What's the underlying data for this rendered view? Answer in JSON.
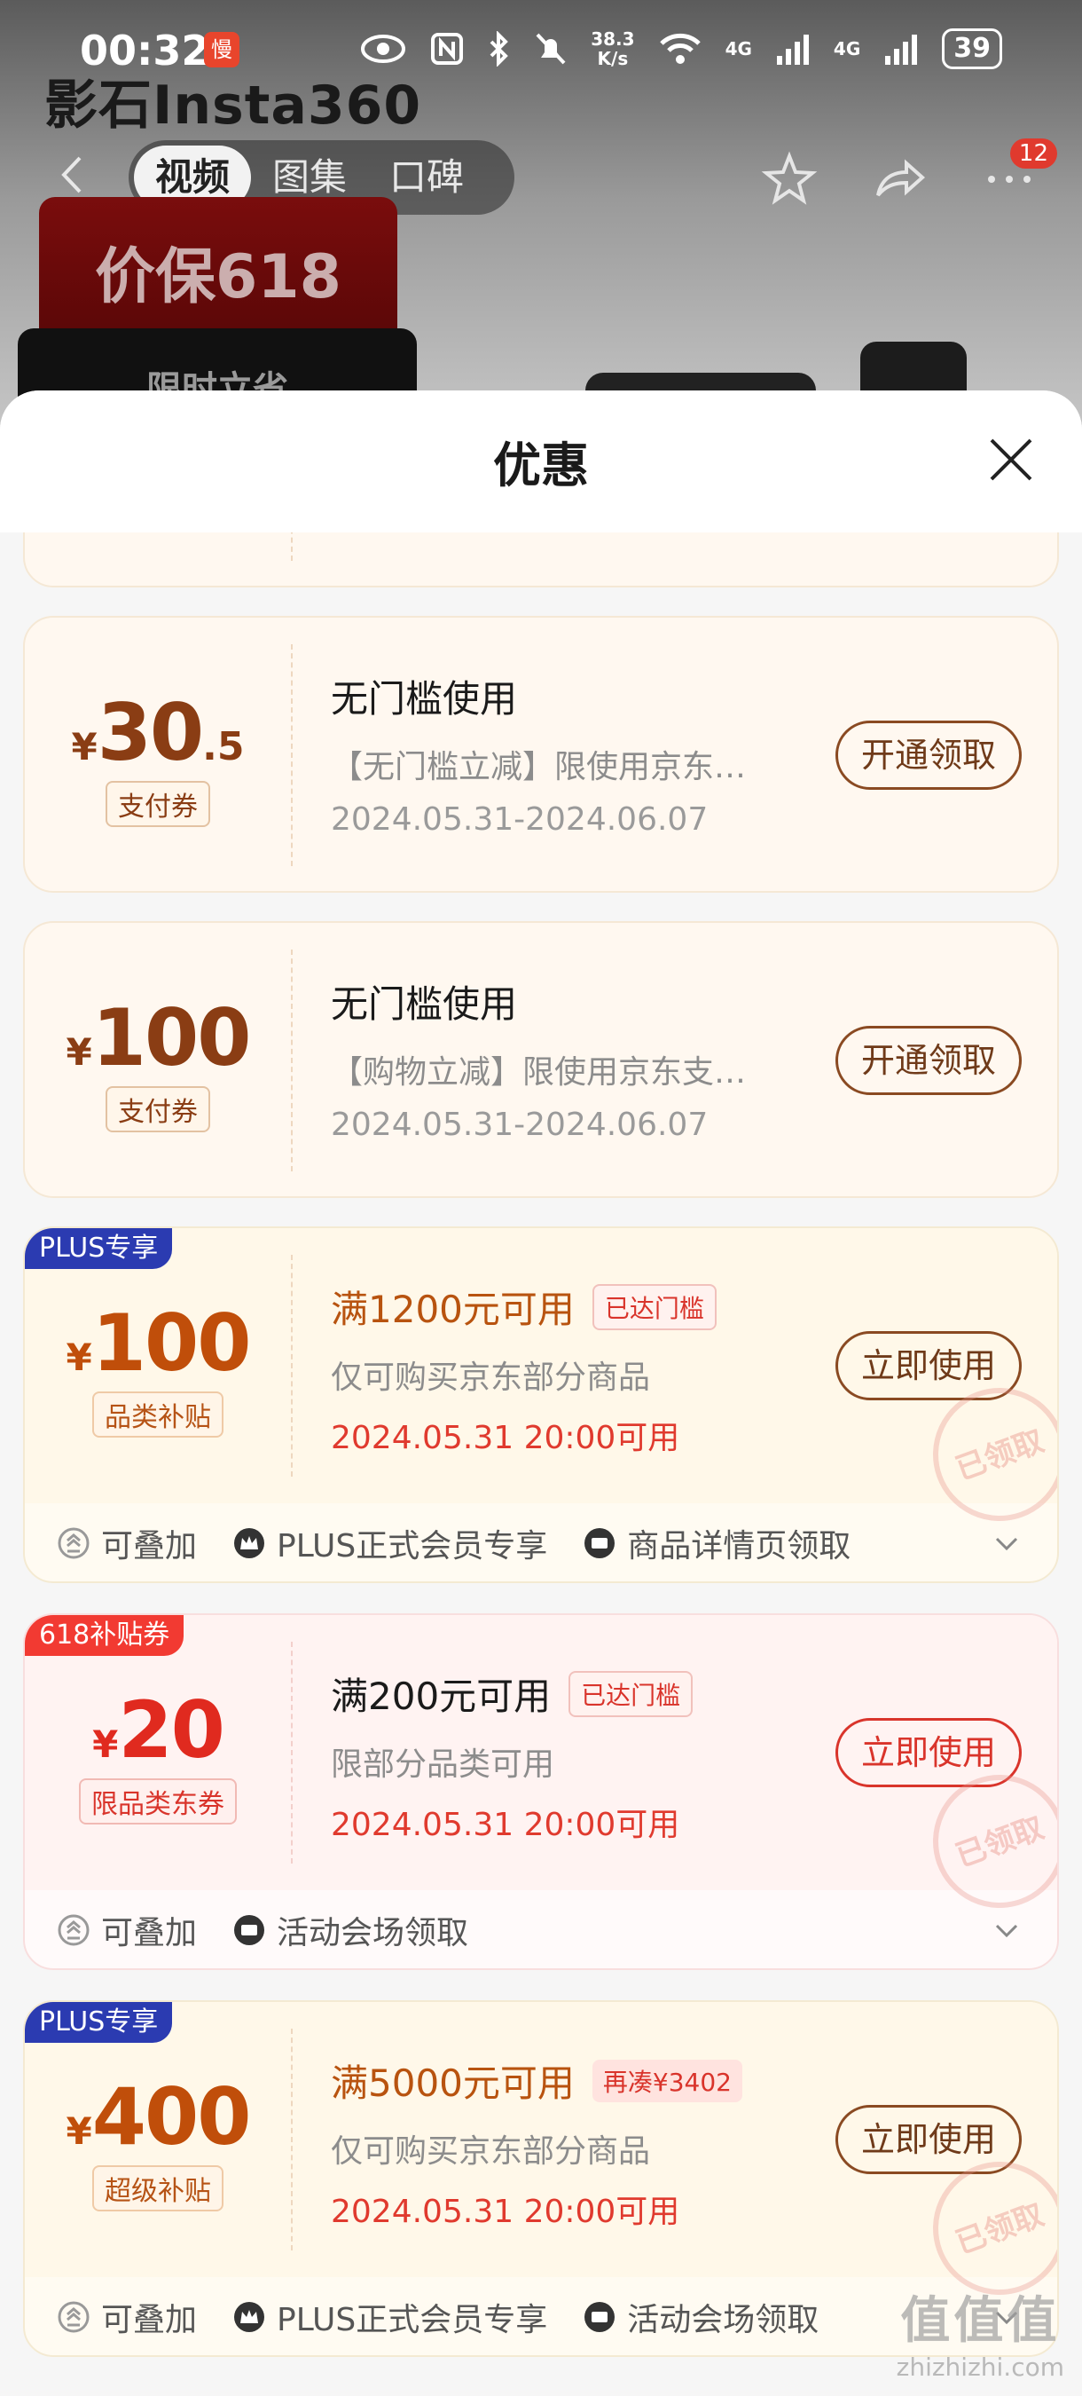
{
  "status_bar": {
    "time": "00:32",
    "app_badge": "慢",
    "net_speed_top": "38.3",
    "net_speed_bottom": "K/s",
    "signal_1": "4G",
    "signal_2": "4G",
    "battery": "39"
  },
  "page": {
    "brand": "影石Insta360",
    "tabs": [
      "视频",
      "图集",
      "口碑"
    ],
    "active_tab": "视频",
    "notification_count": "12",
    "promo_banner": "价保618",
    "promo_sub": "限时立省"
  },
  "sheet": {
    "title": "优惠"
  },
  "coupons": [
    {
      "amount_int": "30",
      "amount_dec": ".5",
      "type_label": "支付券",
      "title": "无门槛使用",
      "desc": "【无门槛立减】限使用京东…",
      "date": "2024.05.31-2024.06.07",
      "button": "开通领取"
    },
    {
      "amount_int": "100",
      "amount_dec": "",
      "type_label": "支付券",
      "title": "无门槛使用",
      "desc": "【购物立减】限使用京东支…",
      "date": "2024.05.31-2024.06.07",
      "button": "开通领取"
    },
    {
      "corner_tag": "PLUS专享",
      "amount_int": "100",
      "type_label": "品类补贴",
      "title": "满1200元可用",
      "chip": "已达门槛",
      "desc": "仅可购买京东部分商品",
      "date": "2024.05.31 20:00可用",
      "button": "立即使用",
      "stamp": "已领取",
      "features": [
        "可叠加",
        "PLUS正式会员专享",
        "商品详情页领取"
      ]
    },
    {
      "corner_tag": "618补贴券",
      "amount_int": "20",
      "type_label": "限品类东券",
      "title": "满200元可用",
      "chip": "已达门槛",
      "desc": "限部分品类可用",
      "date": "2024.05.31 20:00可用",
      "button": "立即使用",
      "stamp": "已领取",
      "features": [
        "可叠加",
        "活动会场领取"
      ]
    },
    {
      "corner_tag": "PLUS专享",
      "amount_int": "400",
      "type_label": "超级补贴",
      "title": "满5000元可用",
      "chip": "再凑¥3402",
      "desc": "仅可购买京东部分商品",
      "date": "2024.05.31 20:00可用",
      "button": "立即使用",
      "stamp": "已领取",
      "features": [
        "可叠加",
        "PLUS正式会员专享",
        "活动会场领取"
      ]
    }
  ],
  "currency": "¥",
  "watermark": {
    "big": "值值值",
    "small": "zhizhizhi.com"
  },
  "colors": {
    "plus_tag": "#2b3bb1",
    "tag_618": "#f23a32",
    "price_brown": "#8a3d14",
    "price_orange": "#c04e0a",
    "price_red": "#e02a1f"
  }
}
